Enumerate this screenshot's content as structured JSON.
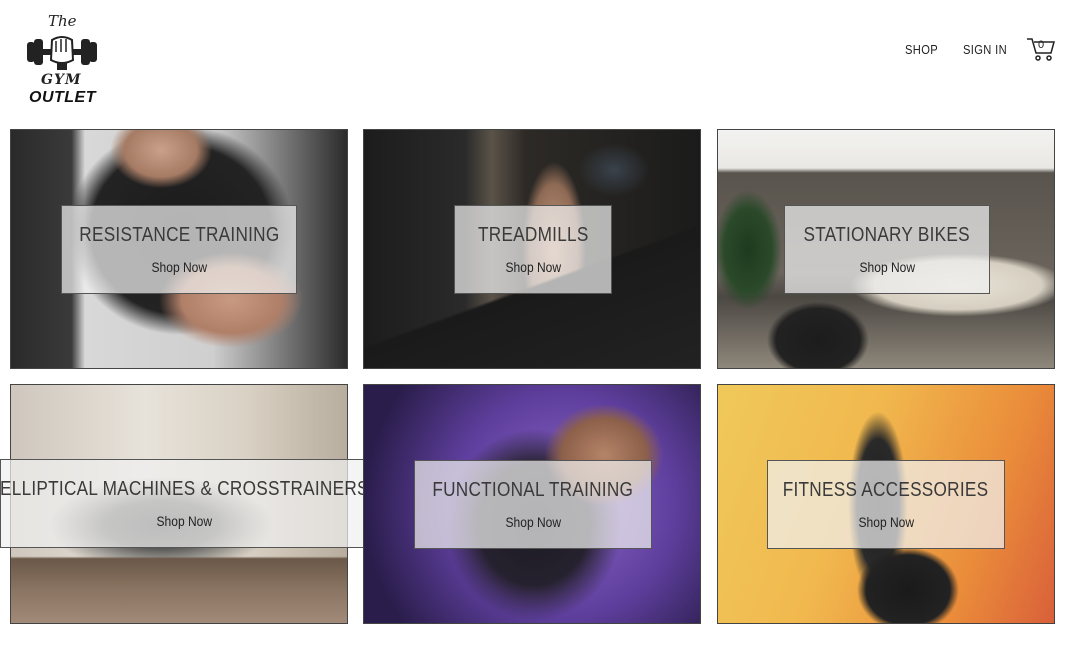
{
  "brand": {
    "the": "The",
    "gym": "GYM",
    "outlet": "OUTLET"
  },
  "nav": {
    "shop": "SHOP",
    "sign_in": "SIGN IN",
    "cart_count": "0"
  },
  "categories": [
    {
      "title": "RESISTANCE TRAINING",
      "cta": "Shop Now"
    },
    {
      "title": "TREADMILLS",
      "cta": "Shop Now"
    },
    {
      "title": "STATIONARY BIKES",
      "cta": "Shop Now"
    },
    {
      "title": "ELLIPTICAL MACHINES & CROSSTRAINERS",
      "cta": "Shop Now"
    },
    {
      "title": "FUNCTIONAL TRAINING",
      "cta": "Shop Now"
    },
    {
      "title": "FITNESS ACCESSORIES",
      "cta": "Shop Now"
    }
  ]
}
